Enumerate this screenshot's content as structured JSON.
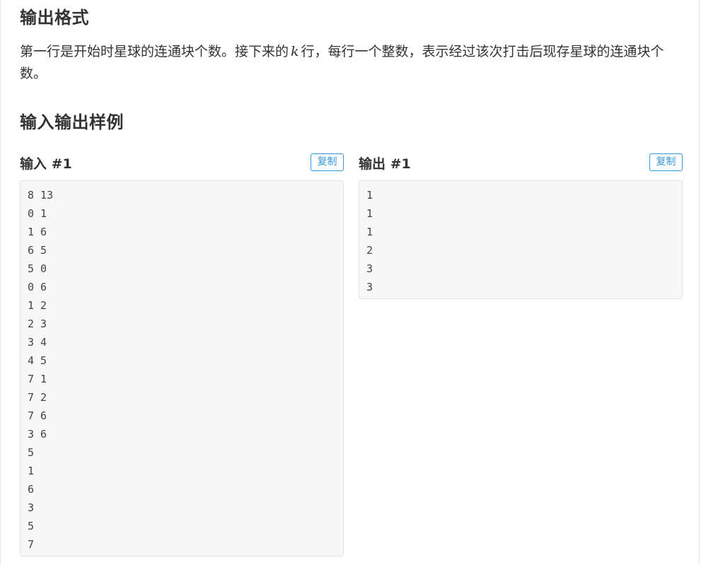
{
  "output_format": {
    "title": "输出格式",
    "text_before_var": "第一行是开始时星球的连通块个数。接下来的",
    "var": "k",
    "text_after_var": "行，每行一个整数，表示经过该次打击后现存星球的连通块个数。"
  },
  "samples": {
    "title": "输入输出样例",
    "input": {
      "label": "输入 #1",
      "copy_label": "复制",
      "lines": [
        "8 13",
        "0 1",
        "1 6",
        "6 5",
        "5 0",
        "0 6",
        "1 2",
        "2 3",
        "3 4",
        "4 5",
        "7 1",
        "7 2",
        "7 6",
        "3 6",
        "5",
        "1",
        "6",
        "3",
        "5",
        "7"
      ]
    },
    "output": {
      "label": "输出 #1",
      "copy_label": "复制",
      "lines": [
        "1",
        "1",
        "1",
        "2",
        "3",
        "3"
      ]
    }
  },
  "colors": {
    "accent": "#3498db",
    "text": "#333333",
    "code_background": "#f7f7f7",
    "code_border": "#e3e3e3"
  }
}
